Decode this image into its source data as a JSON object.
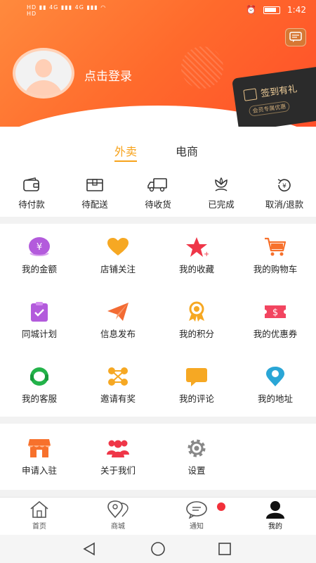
{
  "status_bar": {
    "left": "HD 4G 4G",
    "time": "1:42"
  },
  "header": {
    "login_text": "点击登录",
    "signin_title": "签到有礼",
    "signin_sub": "会员专属优惠",
    "colors": {
      "gradient_start": "#ff8a3d",
      "gradient_end": "#ff4f29"
    }
  },
  "tabs": [
    {
      "label": "外卖",
      "active": true
    },
    {
      "label": "电商",
      "active": false
    }
  ],
  "orders": [
    {
      "label": "待付款",
      "icon": "wallet-icon"
    },
    {
      "label": "待配送",
      "icon": "box-icon"
    },
    {
      "label": "待收货",
      "icon": "truck-icon"
    },
    {
      "label": "已完成",
      "icon": "flower-icon"
    },
    {
      "label": "取消/退款",
      "icon": "refund-icon"
    }
  ],
  "menu": [
    {
      "label": "我的金额",
      "icon": "money-icon",
      "color": "#b35bdc"
    },
    {
      "label": "店铺关注",
      "icon": "heart-icon",
      "color": "#f6a823"
    },
    {
      "label": "我的收藏",
      "icon": "star-icon",
      "color": "#ef3648"
    },
    {
      "label": "我的购物车",
      "icon": "cart-icon",
      "color": "#f7712c"
    },
    {
      "label": "同城计划",
      "icon": "clipboard-icon",
      "color": "#b35bdc"
    },
    {
      "label": "信息发布",
      "icon": "send-icon",
      "color": "#f36b33"
    },
    {
      "label": "我的积分",
      "icon": "medal-icon",
      "color": "#f6a823"
    },
    {
      "label": "我的优惠券",
      "icon": "coupon-icon",
      "color": "#f24560"
    },
    {
      "label": "我的客服",
      "icon": "headset-icon",
      "color": "#23b34a"
    },
    {
      "label": "邀请有奖",
      "icon": "network-icon",
      "color": "#f6a823"
    },
    {
      "label": "我的评论",
      "icon": "comment-icon",
      "color": "#f6a823"
    },
    {
      "label": "我的地址",
      "icon": "location-icon",
      "color": "#2aa6d6"
    }
  ],
  "menu2": [
    {
      "label": "申请入驻",
      "icon": "store-icon",
      "color": "#f7712c"
    },
    {
      "label": "关于我们",
      "icon": "group-icon",
      "color": "#ef3648"
    },
    {
      "label": "设置",
      "icon": "gear-icon",
      "color": "#888888"
    }
  ],
  "bottom_nav": [
    {
      "label": "首页",
      "icon": "home-icon",
      "active": false
    },
    {
      "label": "商城",
      "icon": "map-pin-icon",
      "active": false
    },
    {
      "label": "通知",
      "icon": "chat-icon",
      "active": false,
      "badge": true
    },
    {
      "label": "我的",
      "icon": "user-icon",
      "active": true
    }
  ]
}
